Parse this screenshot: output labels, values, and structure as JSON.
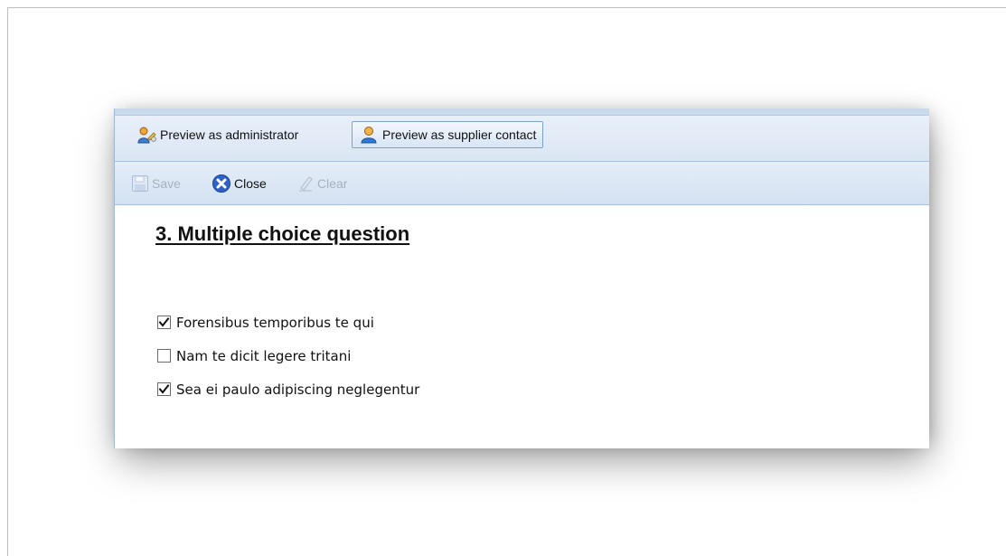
{
  "tabs": {
    "items": [
      {
        "label": "Preview as administrator",
        "icon": "admin-user-icon",
        "active": false
      },
      {
        "label": "Preview as supplier contact",
        "icon": "supplier-contact-icon",
        "active": true
      }
    ]
  },
  "toolbar": {
    "save_label": "Save",
    "save_enabled": false,
    "close_label": "Close",
    "close_enabled": true,
    "clear_label": "Clear",
    "clear_enabled": false
  },
  "question": {
    "title": "3. Multiple choice question",
    "options": [
      {
        "label": "Forensibus temporibus te qui",
        "checked": true
      },
      {
        "label": "Nam te dicit legere tritani",
        "checked": false
      },
      {
        "label": "Sea ei paulo adipiscing neglegentur",
        "checked": true
      }
    ]
  },
  "colors": {
    "toolbar_bg": "#dbe6f4",
    "toolbar_border": "#a9c0dc",
    "disabled_text": "#a7b2bf",
    "close_icon_blue": "#2f62c9"
  }
}
